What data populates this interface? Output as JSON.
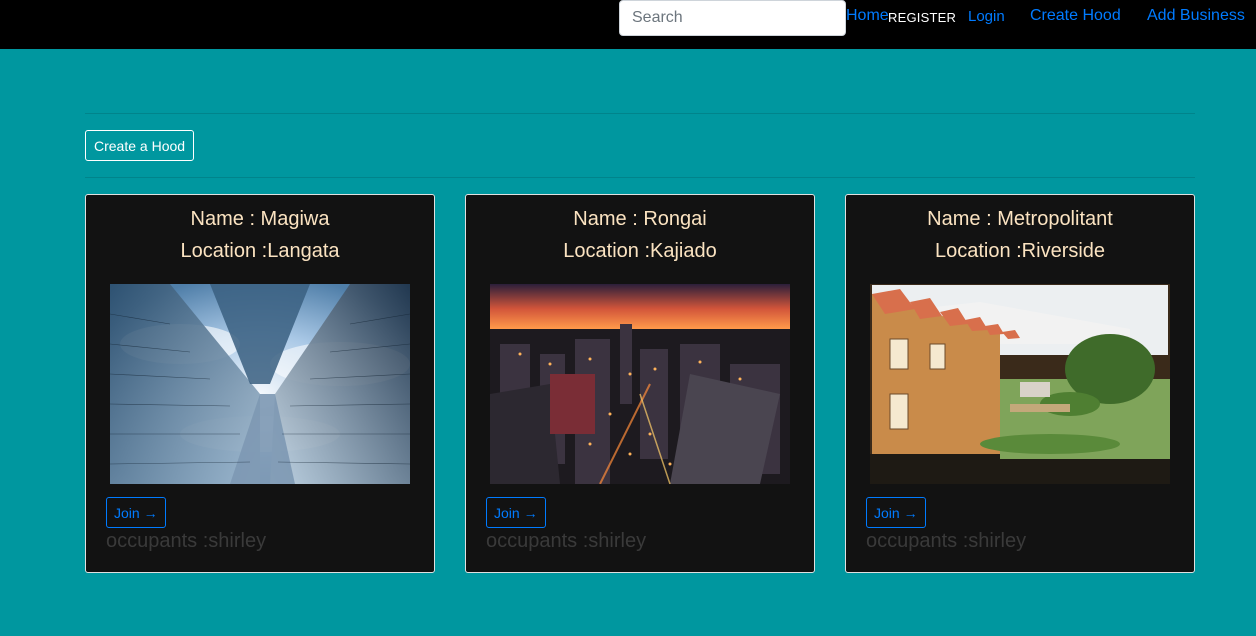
{
  "navbar": {
    "search_placeholder": "Search",
    "home": "Home",
    "register": "REGISTER",
    "login": "Login",
    "create_hood": "Create Hood",
    "add_business": "Add Business"
  },
  "create_hood_button": "Create a Hood",
  "join_label": "Join →",
  "occupants_label": "occupants :",
  "hoods": [
    {
      "name": "Name : Magiwa",
      "location": "Location :Langata",
      "occupants": "shirley",
      "image": "skyscrapers-upward-view"
    },
    {
      "name": "Name : Rongai",
      "location": "Location :Kajiado",
      "occupants": "shirley",
      "image": "city-night-aerial"
    },
    {
      "name": "Name : Metropolitant",
      "location": "Location :Riverside",
      "occupants": "shirley",
      "image": "terraced-houses-garden"
    }
  ],
  "colors": {
    "background": "#00979f",
    "navbar": "#000000",
    "card": "#121212",
    "card_title": "#fbe3c1",
    "link": "#007bff",
    "occupants_text": "#3a3a3a"
  }
}
